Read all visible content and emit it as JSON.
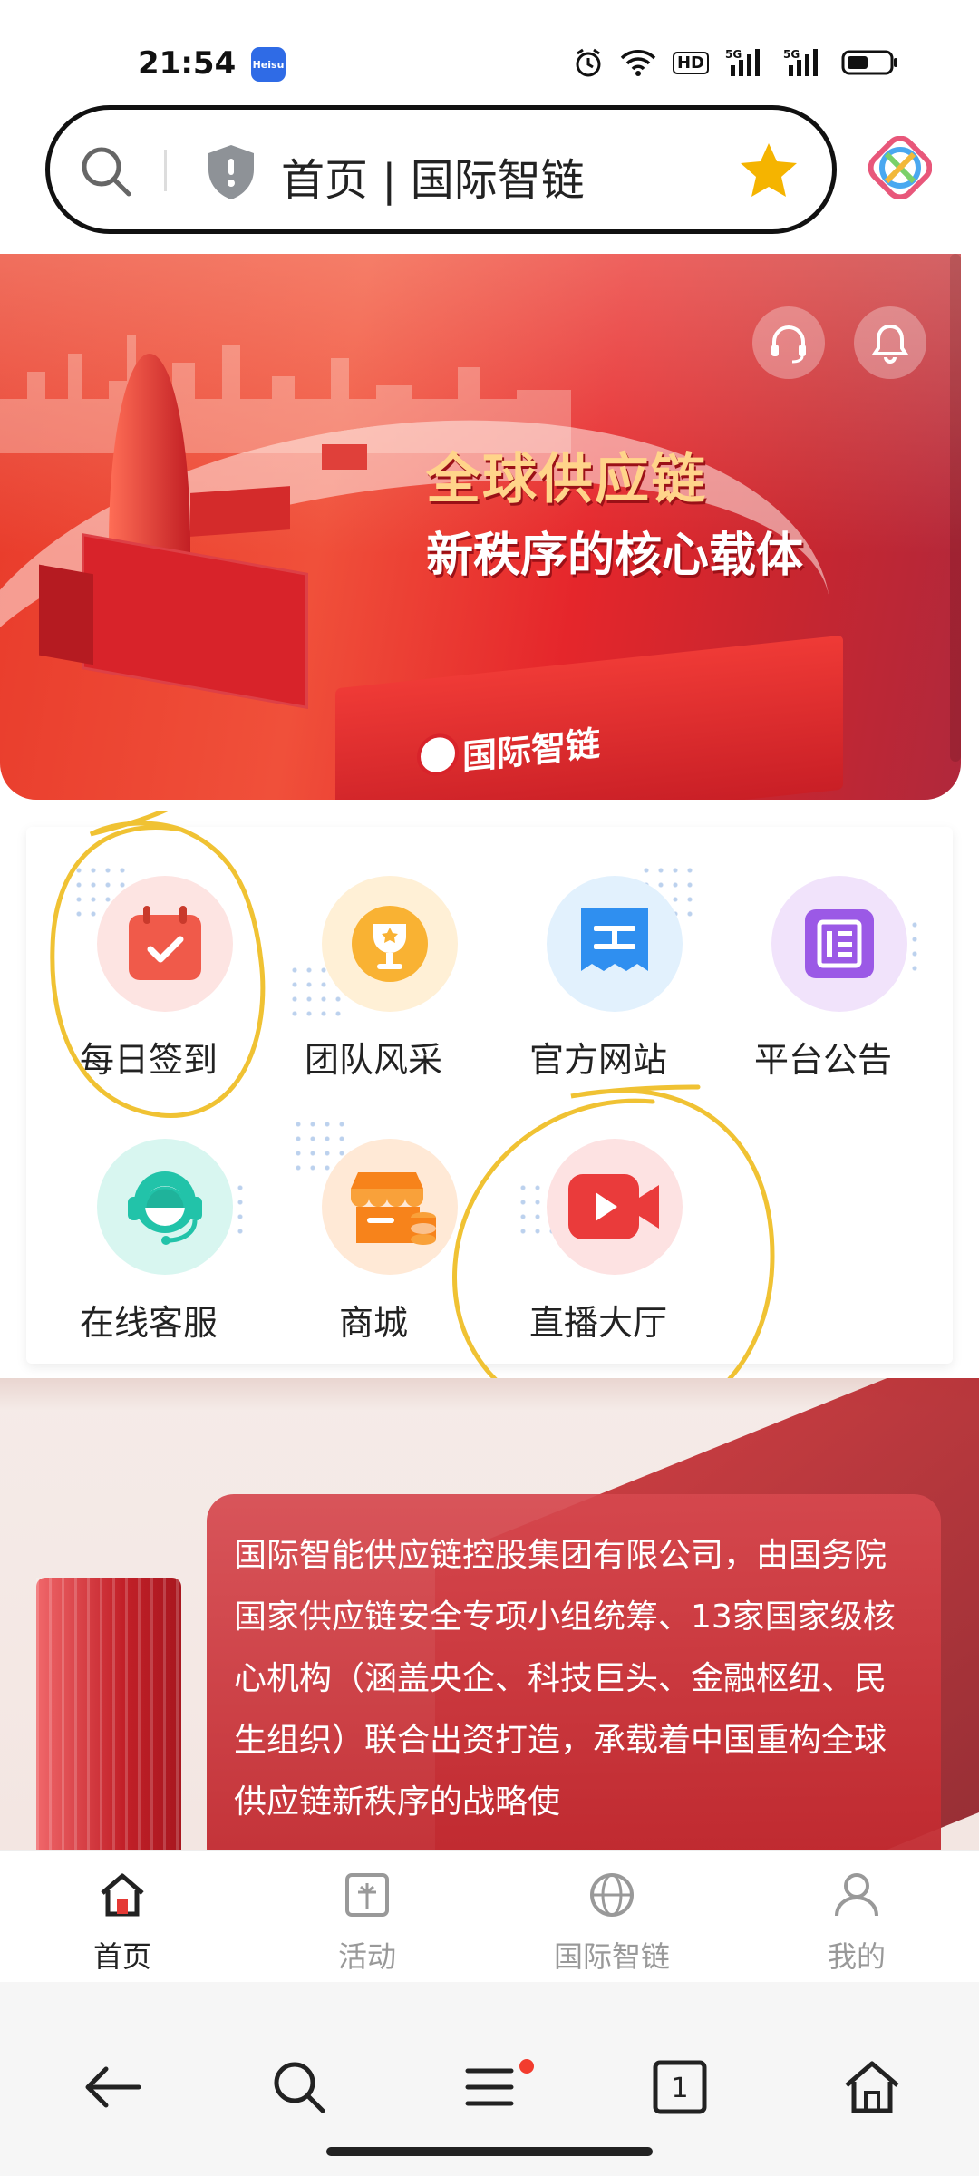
{
  "status_bar": {
    "time": "21:54",
    "app_badge": "Heisu",
    "icons": [
      "alarm-icon",
      "wifi-icon",
      "hd-icon",
      "signal-5g-icon",
      "signal-5g-icon",
      "battery-icon"
    ],
    "hd_label": "HD",
    "net_label": "5G",
    "net_label_2": "5G"
  },
  "address_bar": {
    "title": "首页 | 国际智链",
    "accent_color": "#f5b400"
  },
  "hero": {
    "headline": "全球供应链",
    "subline": "新秩序的核心载体",
    "truck_logo": "国际智链"
  },
  "menu": {
    "items": [
      {
        "label": "每日签到",
        "icon": "calendar-check-icon",
        "color": "#f05a4a"
      },
      {
        "label": "团队风采",
        "icon": "trophy-icon",
        "color": "#f7a21b"
      },
      {
        "label": "官方网站",
        "icon": "website-icon",
        "color": "#2f8ff0"
      },
      {
        "label": "平台公告",
        "icon": "notice-icon",
        "color": "#9b59e6"
      },
      {
        "label": "在线客服",
        "icon": "customer-service-icon",
        "color": "#22c3a9"
      },
      {
        "label": "商城",
        "icon": "shop-icon",
        "color": "#f7831b"
      },
      {
        "label": "直播大厅",
        "icon": "live-video-icon",
        "color": "#ea3b3b"
      }
    ]
  },
  "intro": {
    "text": "国际智能供应链控股集团有限公司，由国务院 国家供应链安全专项小组统筹、13家国家级核心机构（涵盖央企、科技巨头、金融枢纽、民生组织）联合出资打造，承载着中国重构全球供应链新秩序的战略使"
  },
  "tab_bar": {
    "tabs": [
      {
        "label": "首页",
        "icon": "home-icon",
        "active": true
      },
      {
        "label": "活动",
        "icon": "gift-icon",
        "active": false
      },
      {
        "label": "国际智链",
        "icon": "globe-icon",
        "active": false
      },
      {
        "label": "我的",
        "icon": "user-icon",
        "active": false
      }
    ]
  },
  "browser_nav": {
    "tab_count": "1",
    "buttons": [
      "back-icon",
      "search-icon",
      "menu-icon",
      "tabs-icon",
      "home-icon"
    ]
  }
}
